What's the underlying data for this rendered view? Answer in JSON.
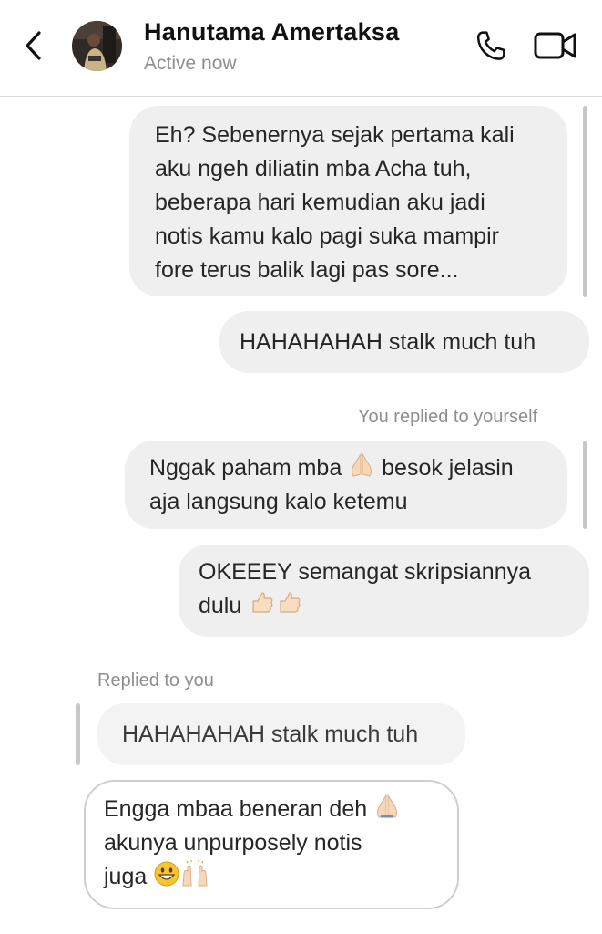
{
  "header": {
    "contact_name": "Hanutama Amertaksa",
    "status": "Active now"
  },
  "messages": {
    "m1": {
      "lines": [
        "Eh? Sebenernya sejak pertama kali",
        "aku ngeh diliatin mba Acha tuh,",
        "beberapa hari kemudian aku jadi",
        "notis kamu kalo pagi suka mampir",
        "fore terus balik lagi pas sore..."
      ]
    },
    "m2": {
      "text": "HAHAHAHAH stalk much tuh"
    },
    "reply_label_self": "You replied to yourself",
    "m3": {
      "line1_a": "Nggak paham mba",
      "line1_b": "besok jelasin",
      "line2": "aja langsung kalo ketemu"
    },
    "m4": {
      "line1": "OKEEEY semangat skripsiannya",
      "line2": "dulu"
    },
    "reply_label_other": "Replied to you",
    "quoted": {
      "text": "HAHAHAHAH stalk much tuh"
    },
    "m5": {
      "line1": "Engga mbaa beneran deh",
      "line2": "akunya unpurposely notis",
      "line3": "juga"
    }
  },
  "icons": {
    "back": "chevron-left-icon",
    "call": "phone-icon",
    "video": "video-camera-icon",
    "pray": "folded-hands-emoji",
    "thumbs": "thumbs-up-emoji",
    "grin": "grinning-face-emoji",
    "raised": "raising-hands-emoji"
  },
  "colors": {
    "sent_bubble": "#efefef",
    "received_border": "#cfcfcf",
    "meta_text": "#8e8e8e",
    "divider": "#dcdcdc"
  }
}
